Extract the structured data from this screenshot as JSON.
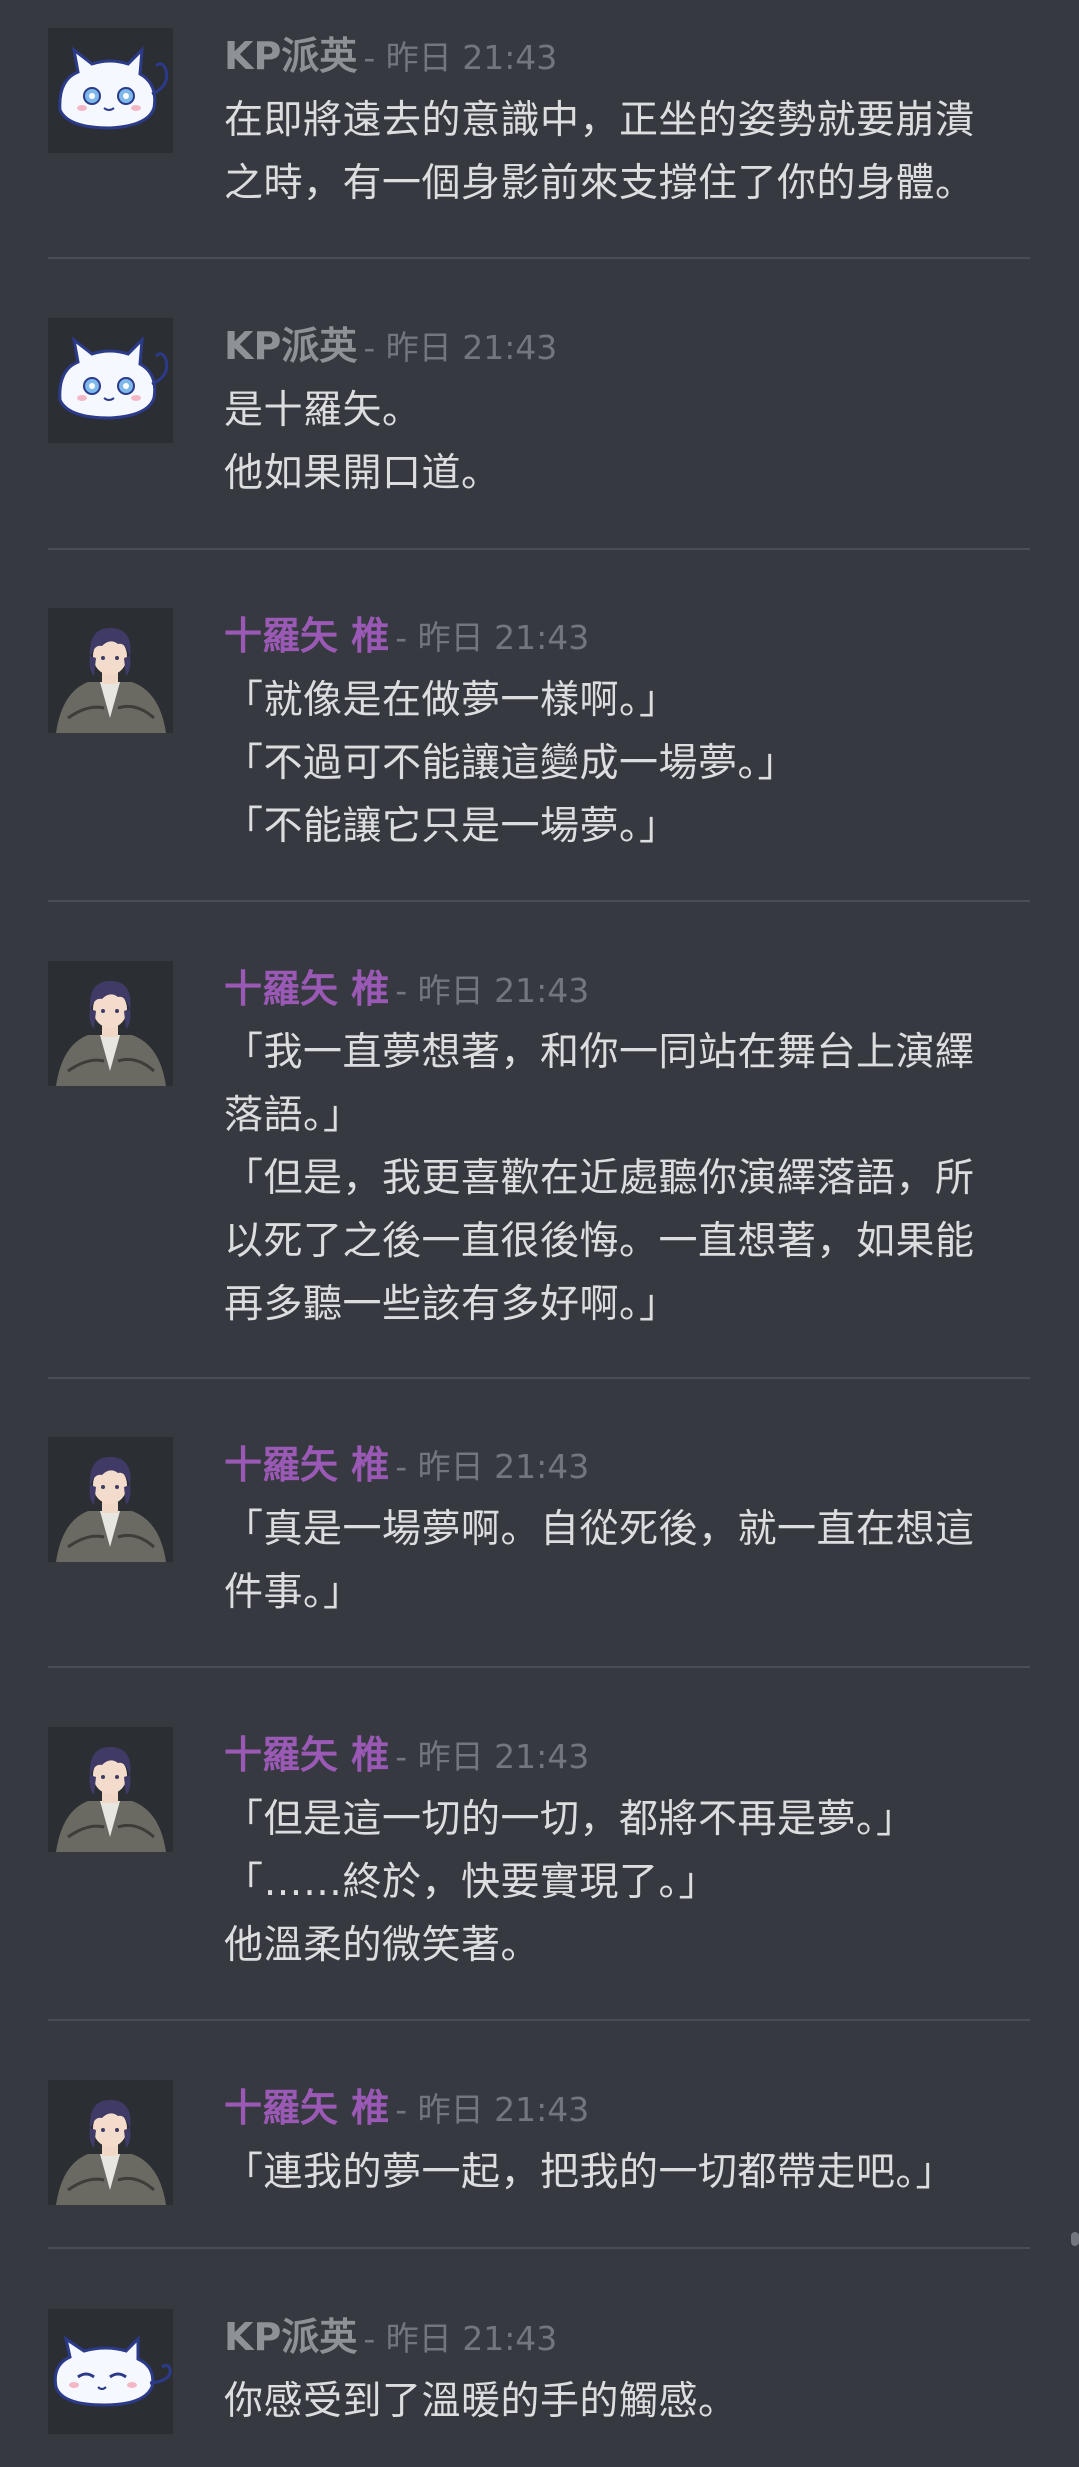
{
  "messages": [
    {
      "author": "KP派英",
      "timestamp": "- 昨日 21:43",
      "lines": [
        "在即將遠去的意識中，正坐的姿勢就要崩潰",
        "之時，有一個身影前來支撐住了你的身體。"
      ]
    },
    {
      "author": "KP派英",
      "timestamp": "- 昨日 21:43",
      "lines": [
        "是十羅矢。",
        "他如果開口道。"
      ]
    },
    {
      "author": "十羅矢 椎",
      "timestamp": "- 昨日 21:43",
      "lines": [
        "「就像是在做夢一樣啊。」",
        "「不過可不能讓這變成一場夢。」",
        "「不能讓它只是一場夢。」"
      ]
    },
    {
      "author": "十羅矢 椎",
      "timestamp": "- 昨日 21:43",
      "lines": [
        "「我一直夢想著，和你一同站在舞台上演繹",
        "落語。」",
        "「但是，我更喜歡在近處聽你演繹落語，所",
        "以死了之後一直很後悔。一直想著，如果能",
        "再多聽一些該有多好啊。」"
      ]
    },
    {
      "author": "十羅矢 椎",
      "timestamp": "- 昨日 21:43",
      "lines": [
        "「真是一場夢啊。自從死後，就一直在想這",
        "件事。」"
      ]
    },
    {
      "author": "十羅矢 椎",
      "timestamp": "- 昨日 21:43",
      "lines": [
        "「但是這一切的一切，都將不再是夢。」",
        "「……終於，快要實現了。」",
        "他溫柔的微笑著。"
      ]
    },
    {
      "author": "十羅矢 椎",
      "timestamp": "- 昨日 21:43",
      "lines": [
        "「連我的夢一起，把我的一切都帶走吧。」"
      ]
    },
    {
      "author": "KP派英",
      "timestamp": "- 昨日 21:43",
      "lines": [
        "你感受到了溫暖的手的觸感。"
      ]
    }
  ],
  "colors": {
    "background": "#36393f",
    "divider": "#4a4d53",
    "kp_name": "#8e9297",
    "tora_name": "#9b59b6",
    "timestamp": "#72767d",
    "text": "#dcddde"
  },
  "icons": {
    "kp_avatar": "white-cat-icon",
    "kp_avatar_sleeping": "sleeping-white-cat-icon",
    "tora_avatar": "purple-haired-man-icon"
  }
}
